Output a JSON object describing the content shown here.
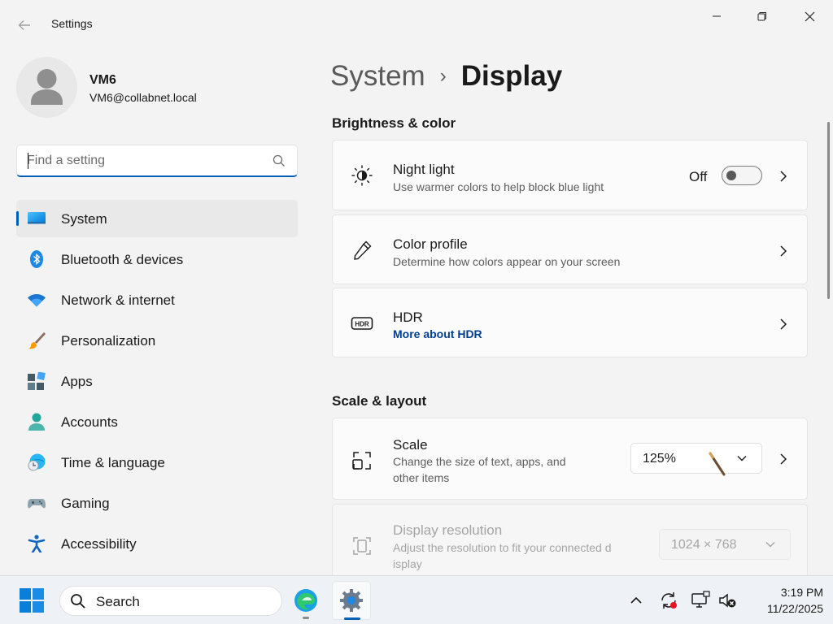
{
  "window": {
    "title": "Settings"
  },
  "profile": {
    "name": "VM6",
    "email": "VM6@collabnet.local"
  },
  "search": {
    "placeholder": "Find a setting",
    "value": ""
  },
  "sidebar": {
    "items": [
      {
        "label": "System",
        "icon": "system-monitor-icon",
        "active": true
      },
      {
        "label": "Bluetooth & devices",
        "icon": "bluetooth-icon",
        "active": false
      },
      {
        "label": "Network & internet",
        "icon": "wifi-icon",
        "active": false
      },
      {
        "label": "Personalization",
        "icon": "paintbrush-icon",
        "active": false
      },
      {
        "label": "Apps",
        "icon": "apps-icon",
        "active": false
      },
      {
        "label": "Accounts",
        "icon": "accounts-icon",
        "active": false
      },
      {
        "label": "Time & language",
        "icon": "globe-clock-icon",
        "active": false
      },
      {
        "label": "Gaming",
        "icon": "gamepad-icon",
        "active": false
      },
      {
        "label": "Accessibility",
        "icon": "accessibility-icon",
        "active": false
      }
    ]
  },
  "breadcrumb": {
    "parent": "System",
    "separator": "›",
    "current": "Display"
  },
  "sections": {
    "brightness": {
      "title": "Brightness & color",
      "night_light": {
        "title": "Night light",
        "subtitle": "Use warmer colors to help block blue light",
        "toggle_state": "Off",
        "toggle_on": false
      },
      "color_profile": {
        "title": "Color profile",
        "subtitle": "Determine how colors appear on your screen"
      },
      "hdr": {
        "title": "HDR",
        "link": "More about HDR"
      }
    },
    "scale_layout": {
      "title": "Scale & layout",
      "scale": {
        "title": "Scale",
        "subtitle_line1": "Change the size of text, apps, and",
        "subtitle_line2": "other items",
        "value": "125%"
      },
      "resolution": {
        "title": "Display resolution",
        "subtitle_line1": "Adjust the resolution to fit your connected d",
        "subtitle_line2": "isplay",
        "value": "1024 × 768",
        "enabled": false
      }
    }
  },
  "taskbar": {
    "search_label": "Search",
    "time": "3:19 PM",
    "date": "11/22/2025"
  },
  "colors": {
    "accent": "#005fb8",
    "link": "#003e92",
    "background": "#f3f3f3"
  }
}
